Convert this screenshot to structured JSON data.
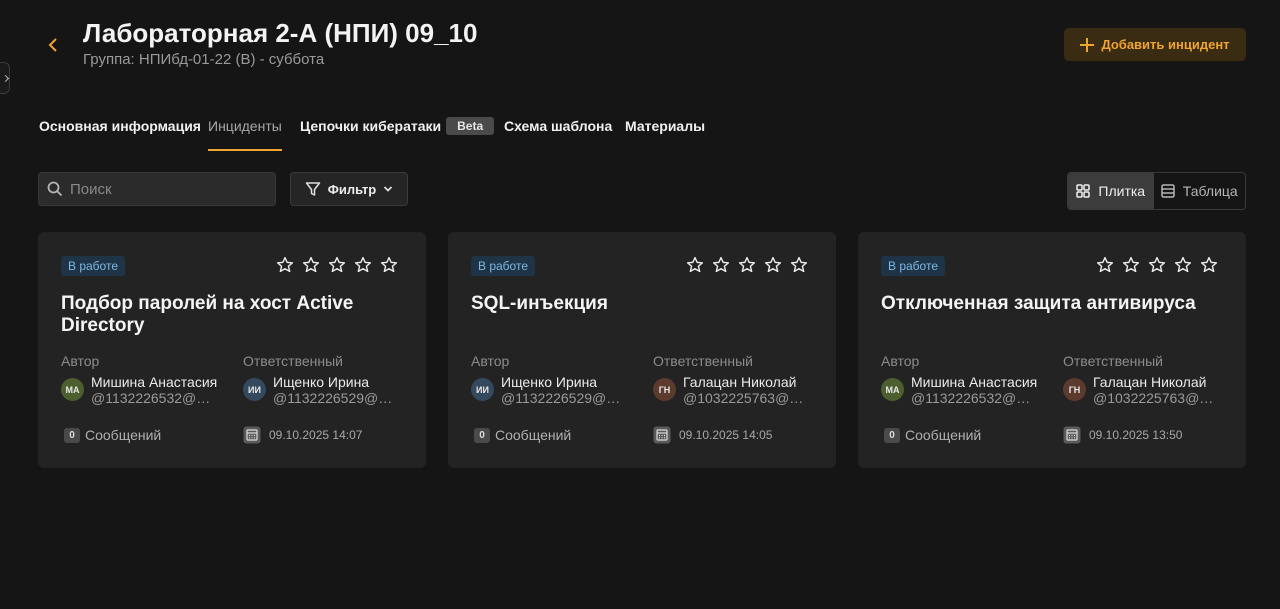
{
  "header": {
    "title": "Лабораторная 2-А (НПИ) 09_10",
    "subtitle": "Группа: НПИбд-01-22 (В) - суббота",
    "add_button_label": "Добавить инцидент"
  },
  "tabs": [
    {
      "label": "Основная информация",
      "active": false
    },
    {
      "label": "Инциденты",
      "active": true
    },
    {
      "label": "Цепочки кибератаки",
      "badge": "Beta",
      "active": false
    },
    {
      "label": "Схема шаблона",
      "active": false
    },
    {
      "label": "Материалы",
      "active": false
    }
  ],
  "toolbar": {
    "search_placeholder": "Поиск",
    "filter_label": "Фильтр",
    "view_tile_label": "Плитка",
    "view_table_label": "Таблица",
    "active_view": "tile"
  },
  "labels": {
    "author": "Автор",
    "responsible": "Ответственный",
    "messages": "Сообщений"
  },
  "colors": {
    "accent": "#f0a432",
    "status_bg": "#1f3447",
    "status_text": "#7eb8e4"
  },
  "cards": [
    {
      "status": "В работе",
      "title": "Подбор паролей на хост Active Directory",
      "rating": 0,
      "author": {
        "initials": "МА",
        "name": "Мишина Анастасия",
        "handle": "@1132226532@pf...",
        "avatar_color": "#4d5e2f"
      },
      "responsible": {
        "initials": "ИИ",
        "name": "Ищенко Ирина",
        "handle": "@1132226529@pf...",
        "avatar_color": "#34495e"
      },
      "messages_count": "0",
      "date": "09.10.2025 14:07"
    },
    {
      "status": "В работе",
      "title": "SQL-инъекция",
      "rating": 0,
      "author": {
        "initials": "ИИ",
        "name": "Ищенко Ирина",
        "handle": "@1132226529@pf...",
        "avatar_color": "#34495e"
      },
      "responsible": {
        "initials": "ГН",
        "name": "Галацан Николай",
        "handle": "@1032225763@pf...",
        "avatar_color": "#5c3a2e"
      },
      "messages_count": "0",
      "date": "09.10.2025 14:05"
    },
    {
      "status": "В работе",
      "title": "Отключенная защита антивируса",
      "rating": 0,
      "author": {
        "initials": "МА",
        "name": "Мишина Анастасия",
        "handle": "@1132226532@pf...",
        "avatar_color": "#4d5e2f"
      },
      "responsible": {
        "initials": "ГН",
        "name": "Галацан Николай",
        "handle": "@1032225763@pf...",
        "avatar_color": "#5c3a2e"
      },
      "messages_count": "0",
      "date": "09.10.2025 13:50"
    }
  ]
}
